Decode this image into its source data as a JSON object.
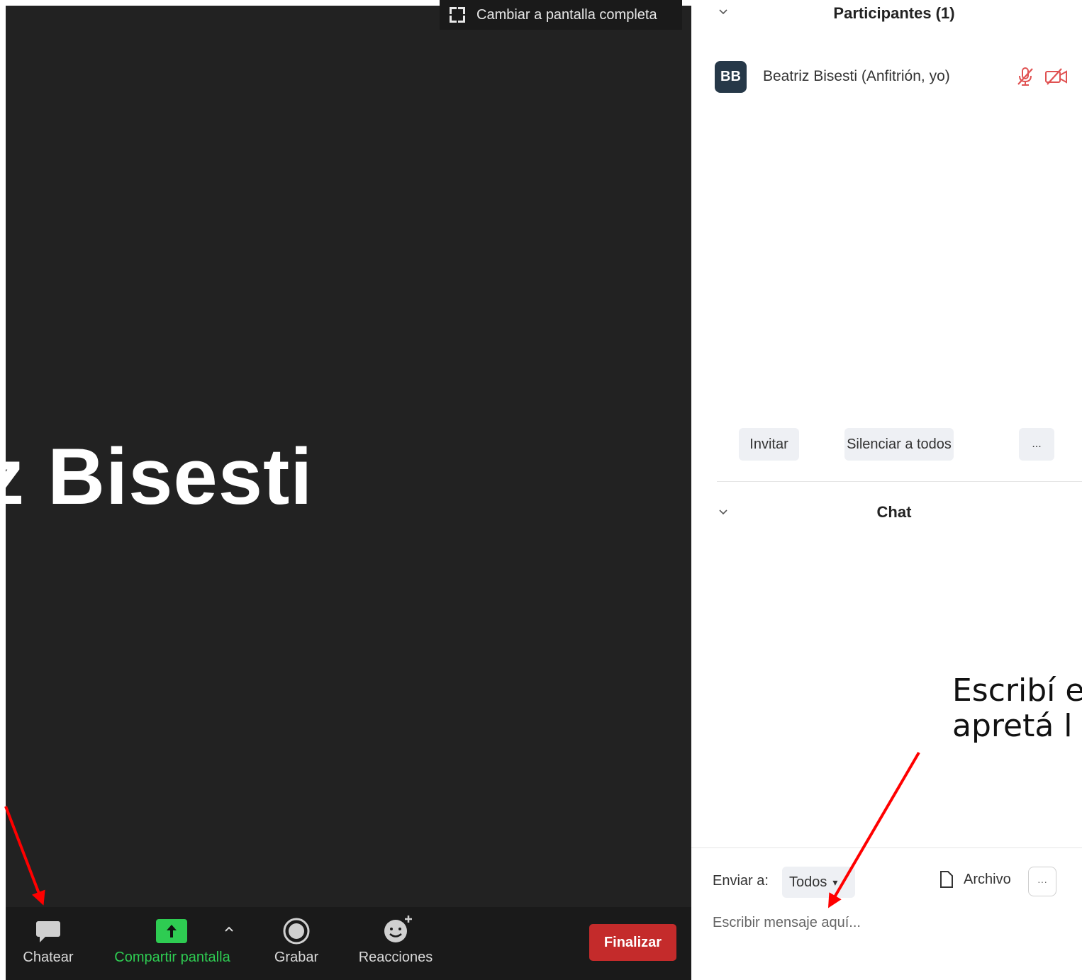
{
  "meeting": {
    "fullscreen_label": "Cambiar a pantalla completa",
    "speaker_name": "z Bisesti"
  },
  "toolbar": {
    "chat_label": "Chatear",
    "share_label": "Compartir pantalla",
    "record_label": "Grabar",
    "reactions_label": "Reacciones",
    "end_label": "Finalizar"
  },
  "participants": {
    "title": "Participantes (1)",
    "items": [
      {
        "initials": "BB",
        "name": "Beatriz Bisesti (Anfitrión, yo)"
      }
    ],
    "invite_label": "Invitar",
    "mute_all_label": "Silenciar a todos",
    "more_label": "..."
  },
  "chat": {
    "title": "Chat",
    "send_to_label": "Enviar a:",
    "send_to_value": "Todos",
    "file_label": "Archivo",
    "more_label": "···",
    "input_placeholder": "Escribir mensaje aquí..."
  },
  "annotation": {
    "line1": "Escribí e",
    "line2": "apretá l"
  },
  "colors": {
    "meeting_bg": "#222222",
    "share_green": "#2ecc52",
    "end_red": "#c42b2b",
    "avatar_bg": "#263848",
    "arrow_red": "#ff0000"
  }
}
